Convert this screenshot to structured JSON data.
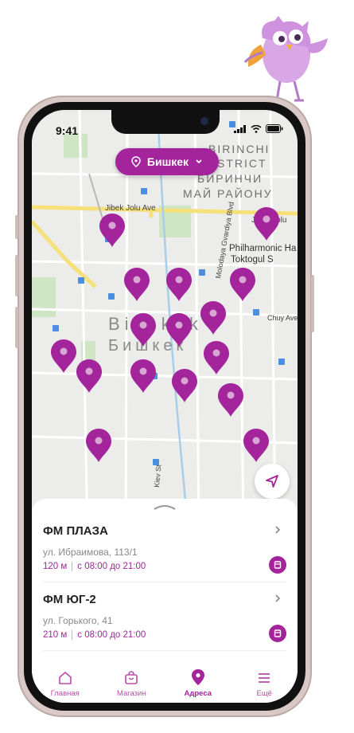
{
  "status": {
    "time": "9:41"
  },
  "city": {
    "label": "Бишкек"
  },
  "map_labels": {
    "district_line1": "BIRINCHI",
    "district_line2": "DISTRICT",
    "district_line3": "БИРИНЧИ",
    "district_line4": "МАЙ РАЙОНУ",
    "street1": "Jibek Jolu Ave",
    "street2": "Jibek Jolu",
    "street3": "Chuy Ave",
    "street4": "Kiev St",
    "street5": "Molodaya Gvardiya Blvd",
    "poi1": "Philharmonic Ha",
    "poi2": "Toktogul S",
    "city_latin": "Bishkek",
    "city_cyr": "Бишкек"
  },
  "stores": [
    {
      "name": "ФМ ПЛАЗА",
      "address": "ул. Ибраимова, 113/1",
      "distance": "120 м",
      "hours": "с 08:00 до 21:00"
    },
    {
      "name": "ФМ ЮГ-2",
      "address": "ул. Горького, 41",
      "distance": "210 м",
      "hours": "с 08:00 до 21:00"
    }
  ],
  "nav": [
    {
      "label": "Главная",
      "icon": "home-icon"
    },
    {
      "label": "Магазин",
      "icon": "shopping-bag-icon"
    },
    {
      "label": "Адреса",
      "icon": "location-pin-icon"
    },
    {
      "label": "Ещё",
      "icon": "menu-icon"
    }
  ],
  "colors": {
    "accent": "#a3249b",
    "pin": "#a3249b",
    "map_bg": "#ececea",
    "road_major": "#f5e07a"
  }
}
